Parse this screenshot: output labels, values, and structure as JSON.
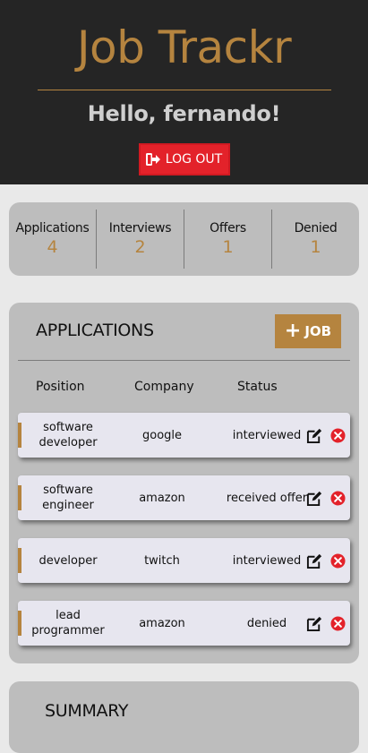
{
  "header": {
    "brand": "Job Trackr",
    "greeting": "Hello, fernando!",
    "logout_label": "LOG OUT",
    "brand_color": "#b5843f",
    "logout_color": "#e3222a"
  },
  "stats": [
    {
      "label": "Applications",
      "value": "4"
    },
    {
      "label": "Interviews",
      "value": "2"
    },
    {
      "label": "Offers",
      "value": "1"
    },
    {
      "label": "Denied",
      "value": "1"
    }
  ],
  "applications": {
    "title": "APPLICATIONS",
    "add_label": "JOB",
    "columns": [
      "Position",
      "Company",
      "Status"
    ],
    "rows": [
      {
        "position": "software developer",
        "company": "google",
        "status": "interviewed"
      },
      {
        "position": "software engineer",
        "company": "amazon",
        "status": "received offer"
      },
      {
        "position": "developer",
        "company": "twitch",
        "status": "interviewed"
      },
      {
        "position": "lead programmer",
        "company": "amazon",
        "status": "denied"
      }
    ],
    "row_icons": [
      "edit-icon",
      "delete-icon"
    ]
  },
  "summary": {
    "title": "SUMMARY"
  }
}
